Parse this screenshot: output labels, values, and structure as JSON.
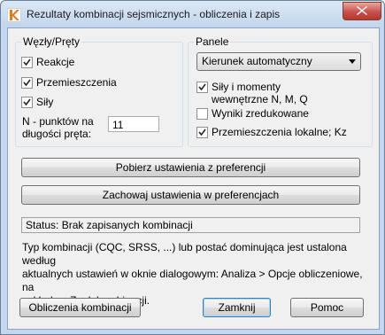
{
  "window": {
    "title": "Rezultaty kombinacji sejsmicznych - obliczenia i zapis"
  },
  "groups": {
    "left_title": "Węzły/Pręty",
    "right_title": "Panele"
  },
  "left": {
    "checkboxes": [
      {
        "label": "Reakcje",
        "checked": true
      },
      {
        "label": "Przemieszczenia",
        "checked": true
      },
      {
        "label": "Siły",
        "checked": true
      }
    ],
    "points_label_line1": "N - punktów na",
    "points_label_line2": "długości pręta:",
    "points_value": "11"
  },
  "right": {
    "direction_select": "Kierunek automatyczny",
    "checkboxes": [
      {
        "label_line1": "Siły i momenty",
        "label_line2": "wewnętrzne N, M, Q",
        "checked": true
      },
      {
        "label_line1": "Wyniki zredukowane",
        "label_line2": "",
        "checked": false
      },
      {
        "label_line1": "Przemieszczenia lokalne; Kz",
        "label_line2": "",
        "checked": true
      }
    ]
  },
  "buttons": {
    "load_prefs": "Pobierz ustawienia z preferencji",
    "save_prefs": "Zachowaj ustawienia w preferencjach",
    "calc": "Obliczenia kombinacji",
    "close": "Zamknij",
    "help": "Pomoc"
  },
  "status_text": "Status: Brak zapisanych kombinacji",
  "info": {
    "line1": "Typ kombinacji (CQC, SRSS, ...) lub postać dominująca jest ustalona według",
    "line2": "aktualnych ustawień w oknie dialogowym: Analiza > Opcje obliczeniowe, na",
    "line3": "zakładce: Znak kombinacji."
  },
  "icons": {
    "app": "app-logo-icon",
    "close": "close-icon",
    "dropdown": "chevron-down-icon",
    "check": "check-icon"
  }
}
